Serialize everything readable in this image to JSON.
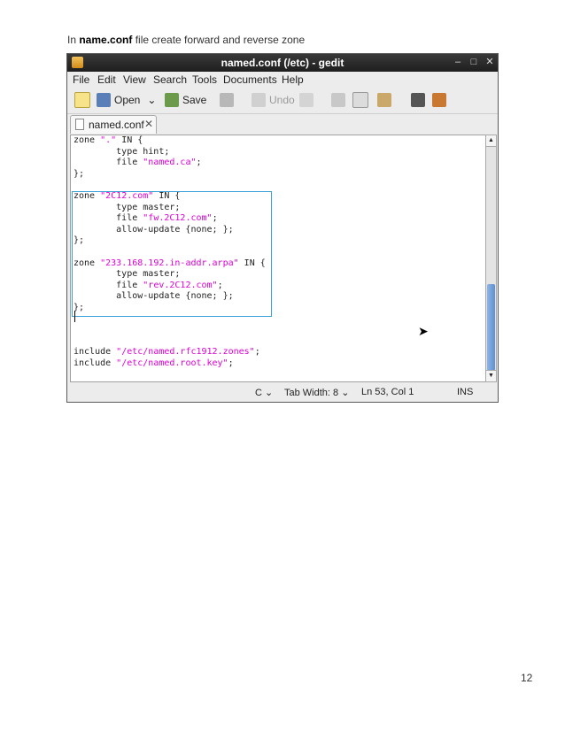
{
  "caption": {
    "prefix": "In ",
    "bold": "name.conf",
    "suffix": " file create forward and reverse zone"
  },
  "page_number": "12",
  "window": {
    "title": "named.conf (/etc) - gedit",
    "controls": {
      "minimize": "–",
      "maximize": "□",
      "close": "✕"
    }
  },
  "menu": [
    "File",
    "Edit",
    "View",
    "Search",
    "Tools",
    "Documents",
    "Help"
  ],
  "toolbar": {
    "open": "Open",
    "open_arrow": "⌄",
    "save": "Save",
    "undo": "Undo"
  },
  "tab": {
    "label": "named.conf",
    "close": "✕"
  },
  "code": {
    "zone1": {
      "kw": "zone ",
      "str": "\".\"",
      "rest": " IN {"
    },
    "type_hint": "        type hint;",
    "file_ca_pre": "        file ",
    "file_ca": "\"named.ca\"",
    "close": "};",
    "zone2": {
      "kw": "zone ",
      "str": "\"2C12.com\"",
      "rest": " IN {"
    },
    "type_master": "        type master;",
    "file_fw_pre": "        file ",
    "file_fw": "\"fw.2C12.com\"",
    "allow_update": "        allow-update {none; };",
    "zone3": {
      "kw": "zone ",
      "str": "\"233.168.192.in-addr.arpa\"",
      "rest": " IN {"
    },
    "file_rev_pre": "        file ",
    "file_rev": "\"rev.2C12.com\"",
    "include": "include ",
    "inc1": "\"/etc/named.rfc1912.zones\"",
    "inc2": "\"/etc/named.root.key\"",
    "semicolon": ";"
  },
  "status": {
    "language": "C ⌄",
    "tab_width": "Tab Width: 8 ⌄",
    "position": "Ln 53, Col 1",
    "mode": "INS"
  },
  "colors": {
    "string": "#e000d8",
    "selection_border": "#3aa0d8",
    "titlebar": "#2a2a2a"
  }
}
